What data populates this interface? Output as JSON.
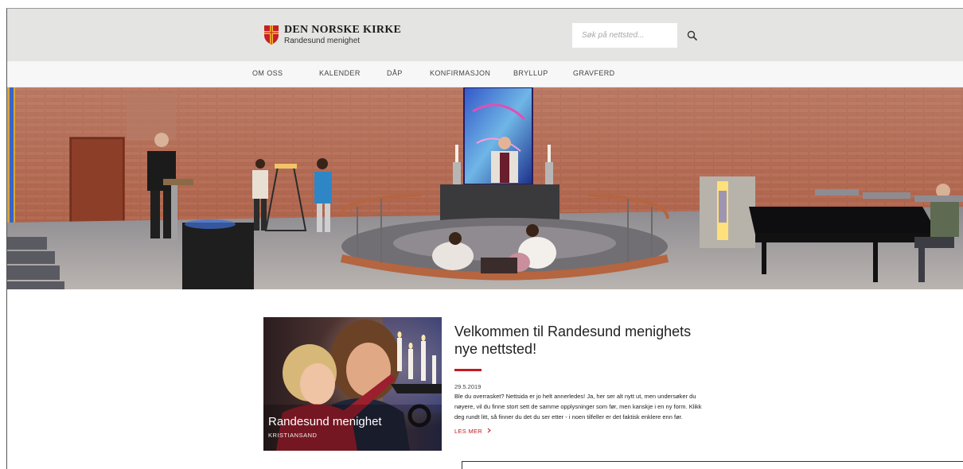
{
  "header": {
    "brand_title": "DEN NORSKE KIRKE",
    "brand_subtitle": "Randesund menighet",
    "search_placeholder": "Søk på nettsted...",
    "logo_icon": "church-cross-shield-icon",
    "search_icon": "magnifier-icon"
  },
  "nav": {
    "items": [
      {
        "label": "OM OSS"
      },
      {
        "label": "KALENDER"
      },
      {
        "label": "DÅP"
      },
      {
        "label": "KONFIRMASJON"
      },
      {
        "label": "BRYLLUP"
      },
      {
        "label": "GRAVFERD"
      }
    ]
  },
  "article": {
    "image_title": "Randesund menighet",
    "image_subtitle": "KRISTIANSAND",
    "title": "Velkommen til Randesund menighets nye nettsted!",
    "date": "29.5.2019",
    "body": "Ble du overrasket? Nettsida er jo helt annerledes! Ja, her ser alt nytt ut, men undersøker du nøyere, vil du finne stort sett de samme opplysninger som før, men kanskje i en ny form. Klikk deg rundt litt, så finner du det du ser etter - i noen tilfeller er det faktisk enklere enn før.",
    "read_more": "LES MER",
    "read_more_icon": "chevron-right-icon"
  },
  "colors": {
    "accent_red": "#c41920",
    "header_bg": "#e4e4e2",
    "nav_bg": "#f7f7f7"
  }
}
